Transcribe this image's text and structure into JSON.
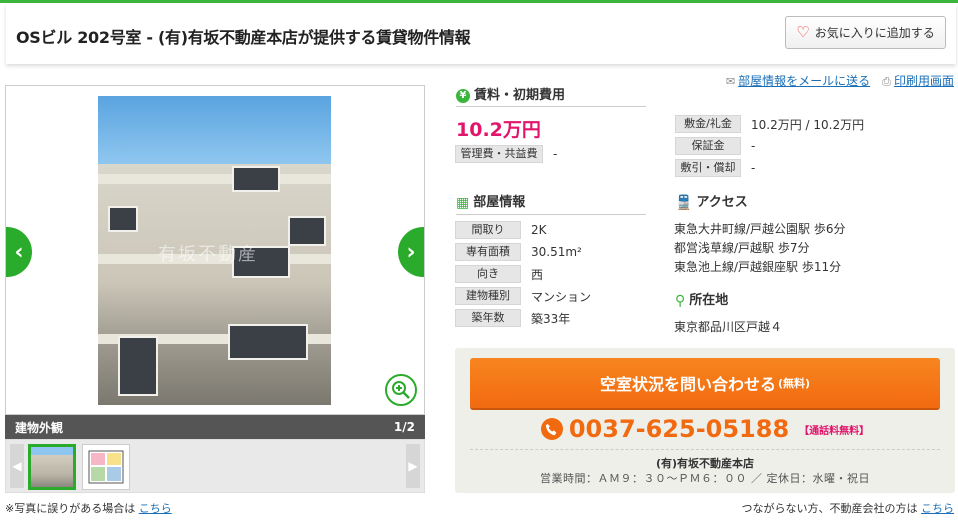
{
  "title": "OSビル 202号室 - (有)有坂不動産本店が提供する賃貸物件情報",
  "fav_button": "お気に入りに追加する",
  "links": {
    "mail": "部屋情報をメールに送る",
    "print": "印刷用画面"
  },
  "gallery": {
    "caption": "建物外観",
    "counter": "1/2",
    "watermark": "有坂不動産"
  },
  "error_note": {
    "text": "※写真に誤りがある場合は",
    "link": "こちら"
  },
  "rent": {
    "heading": "賃料・初期費用",
    "price": "10.2万円",
    "mgmt_label": "管理費・共益費",
    "mgmt_value": "-",
    "items": [
      {
        "label": "敷金/礼金",
        "value": "10.2万円 / 10.2万円"
      },
      {
        "label": "保証金",
        "value": "-"
      },
      {
        "label": "敷引・償却",
        "value": "-"
      }
    ]
  },
  "room": {
    "heading": "部屋情報",
    "items": [
      {
        "label": "間取り",
        "value": "2K"
      },
      {
        "label": "専有面積",
        "value": "30.51m²"
      },
      {
        "label": "向き",
        "value": "西"
      },
      {
        "label": "建物種別",
        "value": "マンション"
      },
      {
        "label": "築年数",
        "value": "築33年"
      }
    ]
  },
  "access": {
    "heading": "アクセス",
    "lines": [
      "東急大井町線/戸越公園駅 歩6分",
      "都営浅草線/戸越駅 歩7分",
      "東急池上線/戸越銀座駅 歩11分"
    ]
  },
  "location": {
    "heading": "所在地",
    "address": "東京都品川区戸越４"
  },
  "contact": {
    "button": "空室状況を問い合わせる",
    "button_note": "(無料)",
    "phone": "0037-625-05188",
    "phone_note": "【通話料無料】",
    "company": "(有)有坂不動産本店",
    "hours": "営業時間：ＡＭ９：３０〜ＰＭ６：００ ／ 定休日：水曜・祝日"
  },
  "bottom_note": {
    "text": "つながらない方、不動産会社の方は",
    "link": "こちら"
  },
  "colors": {
    "accent_green": "#3cb53c",
    "price_pink": "#e0156b",
    "cta_orange": "#f26a10",
    "link_blue": "#1a6fb8"
  }
}
